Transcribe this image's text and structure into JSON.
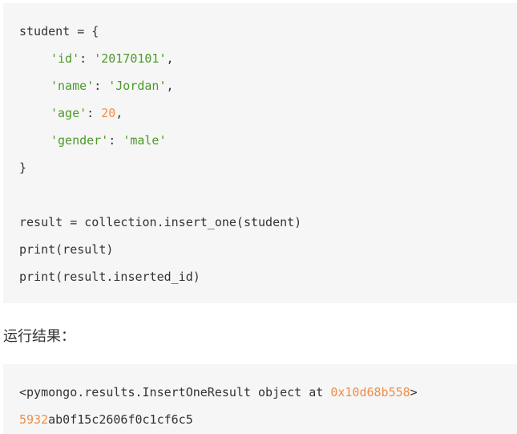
{
  "code1": {
    "l1": "student = {",
    "l2": {
      "key": "'id'",
      "sep": ": ",
      "val": "'20170101'",
      "end": ","
    },
    "l3": {
      "key": "'name'",
      "sep": ": ",
      "val": "'Jordan'",
      "end": ","
    },
    "l4": {
      "key": "'age'",
      "sep": ": ",
      "val": "20",
      "end": ","
    },
    "l5": {
      "key": "'gender'",
      "sep": ": ",
      "val": "'male'",
      "end": ""
    },
    "l6": "}",
    "l7": "result = collection.insert_one(student)",
    "l8": "print(result)",
    "l9": "print(result.inserted_id)"
  },
  "label": "运行结果：",
  "code2": {
    "l1": {
      "pre": "<pymongo.results.InsertOneResult object at ",
      "addr": "0x10d68b558",
      "post": ">"
    },
    "l2": {
      "num": "5932",
      "rest": "ab0f15c2606f0c1cf6c5"
    }
  },
  "colors": {
    "code_bg": "#f6f6f6",
    "text": "#333333",
    "string": "#4c9a2a",
    "number": "#f08d49"
  }
}
